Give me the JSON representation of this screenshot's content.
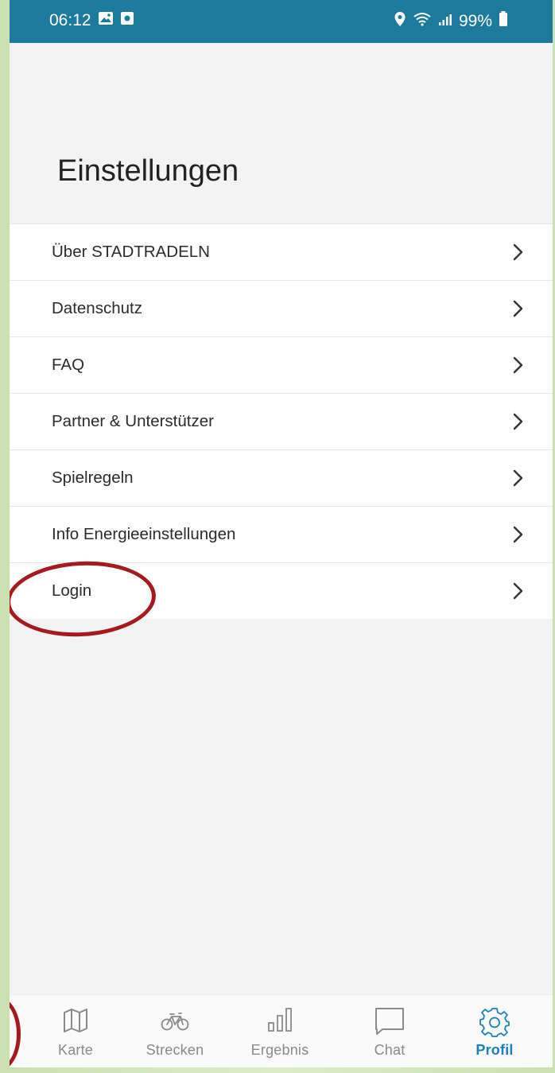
{
  "status_bar": {
    "time": "06:12",
    "battery": "99%",
    "bg_color": "#1d7a9c"
  },
  "page_title": "Einstellungen",
  "menu": {
    "items": [
      {
        "label": "Über STADTRADELN"
      },
      {
        "label": "Datenschutz"
      },
      {
        "label": "FAQ"
      },
      {
        "label": "Partner & Unterstützer"
      },
      {
        "label": "Spielregeln"
      },
      {
        "label": "Info Energieeinstellungen"
      },
      {
        "label": "Login"
      }
    ]
  },
  "bottom_nav": {
    "items": [
      {
        "label": "Karte",
        "icon": "map-icon"
      },
      {
        "label": "Strecken",
        "icon": "bicycle-icon"
      },
      {
        "label": "Ergebnis",
        "icon": "bar-chart-icon"
      },
      {
        "label": "Chat",
        "icon": "chat-icon"
      },
      {
        "label": "Profil",
        "icon": "gear-icon",
        "active": true
      }
    ],
    "active_color": "#1f7fb8"
  },
  "annotation_color": "#a71920"
}
